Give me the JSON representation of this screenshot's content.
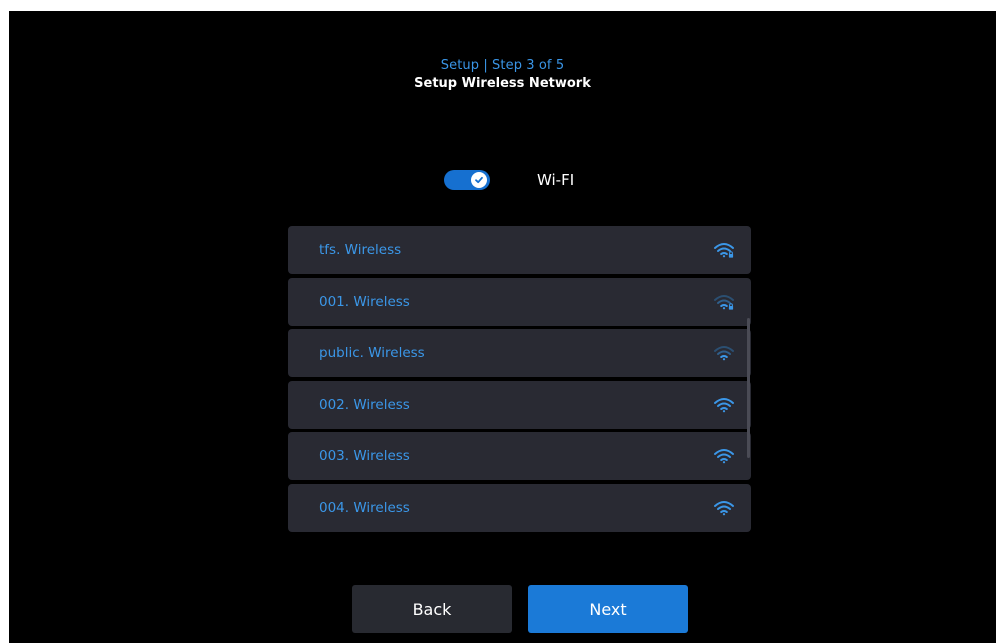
{
  "header": {
    "step": "Setup | Step 3 of 5",
    "title": "Setup Wireless Network"
  },
  "wifi": {
    "label": "Wi-FI",
    "enabled": true
  },
  "networks": [
    {
      "name": "tfs. Wireless",
      "signal": "strong",
      "secured": true
    },
    {
      "name": "001. Wireless",
      "signal": "weak",
      "secured": true
    },
    {
      "name": "public. Wireless",
      "signal": "weak",
      "secured": false
    },
    {
      "name": "002. Wireless",
      "signal": "strong",
      "secured": false
    },
    {
      "name": "003. Wireless",
      "signal": "strong",
      "secured": false
    },
    {
      "name": "004. Wireless",
      "signal": "strong",
      "secured": false
    }
  ],
  "buttons": {
    "back": "Back",
    "next": "Next"
  },
  "colors": {
    "accent": "#1b7ad7",
    "network_text": "#3b97e8",
    "list_bg": "#292a33"
  },
  "icons": {
    "toggle": "check-icon",
    "signal": "wifi-signal-icon",
    "lock": "lock-icon"
  }
}
